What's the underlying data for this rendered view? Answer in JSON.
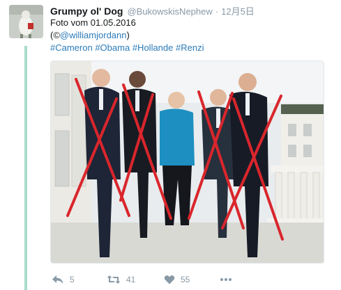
{
  "tweet": {
    "display_name": "Grumpy ol' Dog",
    "handle": "@BukowskisNephew",
    "separator": "·",
    "date": "12月5日",
    "lines": {
      "line1": "Foto vom 01.05.2016",
      "credit_open": "(©",
      "credit_mention": "@williamjordann",
      "credit_close": ")"
    },
    "hashtags": [
      "#Cameron",
      "#Obama",
      "#Hollande",
      "#Renzi"
    ]
  },
  "actions": {
    "reply": {
      "icon": "reply-icon",
      "count": "5"
    },
    "retweet": {
      "icon": "retweet-icon",
      "count": "41"
    },
    "like": {
      "icon": "heart-icon",
      "count": "55"
    },
    "more": {
      "icon": "more-dots-icon"
    }
  },
  "colors": {
    "link": "#2b7bb9",
    "muted": "#8899a6",
    "thread_line": "#a8dcc9",
    "cross": "#d9262c",
    "merkel_jacket": "#1d8fc0"
  }
}
